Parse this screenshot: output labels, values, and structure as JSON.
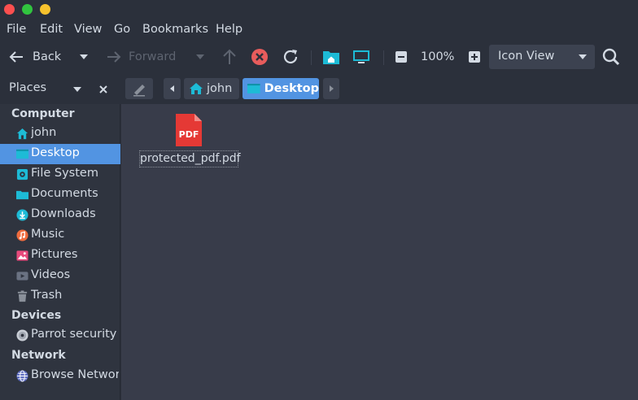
{
  "window": {
    "controls": [
      "close",
      "maximize",
      "minimize"
    ]
  },
  "menubar": {
    "items": [
      "File",
      "Edit",
      "View",
      "Go",
      "Bookmarks",
      "Help"
    ]
  },
  "toolbar": {
    "back_label": "Back",
    "forward_label": "Forward",
    "zoom_value": "100%",
    "view_mode": "Icon View"
  },
  "location": {
    "places_label": "Places",
    "crumbs": [
      "john",
      "Desktop"
    ]
  },
  "sidebar": {
    "sections": [
      {
        "title": "Computer",
        "items": [
          "john",
          "Desktop",
          "File System",
          "Documents",
          "Downloads",
          "Music",
          "Pictures",
          "Videos",
          "Trash"
        ]
      },
      {
        "title": "Devices",
        "items": [
          "Parrot security"
        ]
      },
      {
        "title": "Network",
        "items": [
          "Browse Network"
        ]
      }
    ],
    "selected": "Desktop"
  },
  "files": [
    {
      "name": "protected_pdf.pdf",
      "icon": "pdf-file-icon",
      "badge": "PDF"
    }
  ],
  "colors": {
    "accent": "#5294e2",
    "folder": "#1dbbd6",
    "pdf": "#e53935",
    "stop": "#e85c5c"
  }
}
